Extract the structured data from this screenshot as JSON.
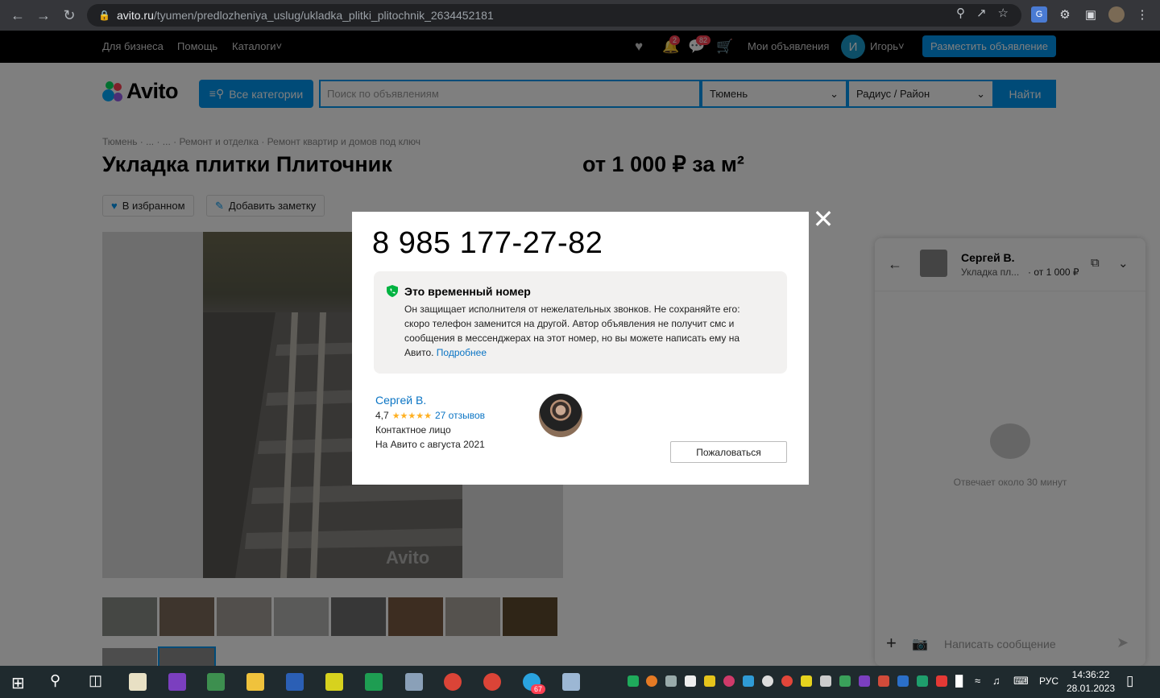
{
  "browser": {
    "url_host": "avito.ru",
    "url_path": "/tyumen/predlozheniya_uslug/ukladka_plitki_plitochnik_2634452181"
  },
  "topnav": {
    "links": [
      "Для бизнеса",
      "Помощь",
      "Каталоги"
    ],
    "notifications_badge": "2",
    "messages_badge": "82",
    "my_ads": "Мои объявления",
    "user_initial": "И",
    "user_name": "Игорь",
    "post_ad": "Разместить объявление"
  },
  "header": {
    "logo": "Avito",
    "categories_btn": "Все категории",
    "search_placeholder": "Поиск по объявлениям",
    "city": "Тюмень",
    "radius": "Радиус / Район",
    "find_btn": "Найти"
  },
  "listing": {
    "breadcrumbs": "Тюмень · ... · ... · Ремонт и отделка · Ремонт квартир и домов под ключ",
    "title": "Укладка плитки Плиточник",
    "price": "от 1 000 ₽ за м²",
    "favorite_btn": "В избранном",
    "note_btn": "Добавить заметку",
    "watermark": "Avito"
  },
  "chat": {
    "seller": "Сергей В.",
    "ad_short": "Укладка пл...",
    "price_short": "· от 1 000 ₽",
    "response_time": "Отвечает около 30 минут",
    "message_placeholder": "Написать сообщение"
  },
  "modal": {
    "phone": "8 985 177-27-82",
    "notice_title": "Это временный номер",
    "notice_text": "Он защищает исполнителя от нежелательных звонков. Не сохраняйте его: скоро телефон заменится на другой. Автор объявления не получит смс и сообщения в мессенджерах на этот номер, но вы можете написать ему на Авито.",
    "notice_more": "Подробнее",
    "seller_name": "Сергей В.",
    "rating": "4,7",
    "stars": "★★★★★",
    "reviews": "27 отзывов",
    "contact_role": "Контактное лицо",
    "member_since": "На Авито с августа 2021",
    "report_btn": "Пожаловаться"
  },
  "taskbar": {
    "lang": "РУС",
    "time": "14:36:22",
    "date": "28.01.2023",
    "telegram_badge": "67"
  },
  "colors": {
    "accent": "#0097f0",
    "link": "#0a74c4",
    "star": "#ffb021",
    "shield": "#00b341"
  }
}
